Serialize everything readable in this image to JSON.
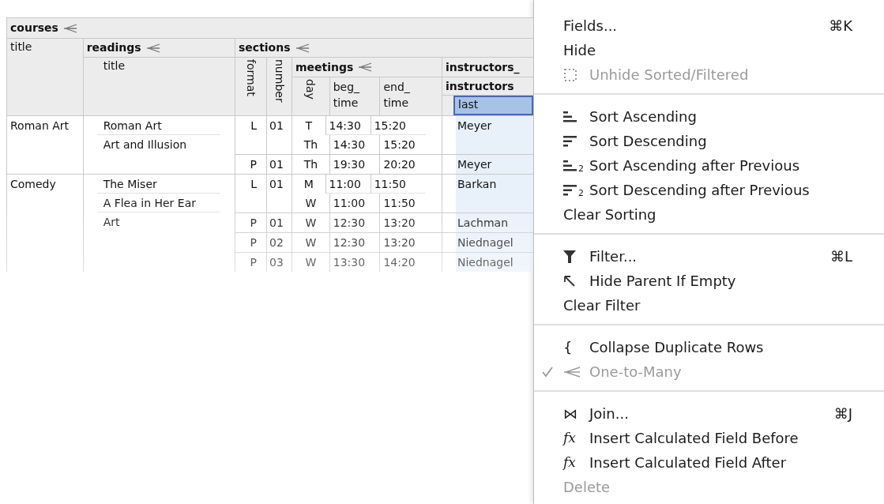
{
  "table": {
    "header": {
      "root": "courses",
      "title": "title",
      "readings": "readings",
      "readings_title": "title",
      "sections": "sections",
      "format": "format",
      "number": "number",
      "meetings": "meetings",
      "day": "day",
      "beg_time": "beg_ time",
      "end_time": "end_ time",
      "instructors_group": "instructors_",
      "instructors": "instructors",
      "last": {
        "label": "last",
        "selected": true
      }
    },
    "courses": [
      {
        "title": "Roman Art",
        "readings": [
          {
            "title": "Roman Art"
          },
          {
            "title": "Art and Illusion"
          }
        ],
        "sections": [
          {
            "format": "L",
            "number": "01",
            "instructor": "Meyer",
            "meetings": [
              {
                "day": "T",
                "beg_time": "14:30",
                "end_time": "15:20"
              },
              {
                "day": "Th",
                "beg_time": "14:30",
                "end_time": "15:20"
              }
            ]
          },
          {
            "format": "P",
            "number": "01",
            "instructor": "Meyer",
            "meetings": [
              {
                "day": "Th",
                "beg_time": "19:30",
                "end_time": "20:20"
              }
            ]
          }
        ]
      },
      {
        "title": "Comedy",
        "readings": [
          {
            "title": "The Miser"
          },
          {
            "title": "A Flea in Her Ear"
          },
          {
            "title": "Art"
          }
        ],
        "sections": [
          {
            "format": "L",
            "number": "01",
            "instructor": "Barkan",
            "meetings": [
              {
                "day": "M",
                "beg_time": "11:00",
                "end_time": "11:50"
              },
              {
                "day": "W",
                "beg_time": "11:00",
                "end_time": "11:50"
              }
            ]
          },
          {
            "format": "P",
            "number": "01",
            "instructor": "Lachman",
            "meetings": [
              {
                "day": "W",
                "beg_time": "12:30",
                "end_time": "13:20"
              }
            ]
          },
          {
            "format": "P",
            "number": "02",
            "instructor": "Niednagel",
            "meetings": [
              {
                "day": "W",
                "beg_time": "12:30",
                "end_time": "13:20"
              }
            ]
          },
          {
            "format": "P",
            "number": "03",
            "instructor": "Niednagel",
            "meetings": [
              {
                "day": "W",
                "beg_time": "13:30",
                "end_time": "14:20"
              }
            ]
          }
        ]
      }
    ]
  },
  "menu": {
    "groups": [
      [
        {
          "label": "Fields...",
          "shortcut": "⌘K",
          "kind": "plain",
          "disabled": false,
          "checked": false
        },
        {
          "label": "Hide",
          "kind": "plain",
          "disabled": false,
          "checked": false
        },
        {
          "label": "Unhide Sorted/Filtered",
          "kind": "dashed-square",
          "disabled": true,
          "checked": false
        }
      ],
      [
        {
          "label": "Sort Ascending",
          "kind": "sort-ascending",
          "disabled": false,
          "checked": false
        },
        {
          "label": "Sort Descending",
          "kind": "sort-descending",
          "disabled": false,
          "checked": false
        },
        {
          "label": "Sort Ascending after Previous",
          "kind": "sort-ascending",
          "subscript": "2",
          "disabled": false,
          "checked": false
        },
        {
          "label": "Sort Descending after Previous",
          "kind": "sort-descending",
          "subscript": "2",
          "disabled": false,
          "checked": false
        },
        {
          "label": "Clear Sorting",
          "kind": "plain",
          "disabled": false,
          "checked": false
        }
      ],
      [
        {
          "label": "Filter...",
          "shortcut": "⌘L",
          "kind": "filter",
          "disabled": false,
          "checked": false
        },
        {
          "label": "Hide Parent If Empty",
          "kind": "arrow-up-left",
          "disabled": false,
          "checked": false
        },
        {
          "label": "Clear Filter",
          "kind": "plain",
          "disabled": false,
          "checked": false
        }
      ],
      [
        {
          "label": "Collapse Duplicate Rows",
          "kind": "glyph",
          "glyph": "{",
          "disabled": false,
          "checked": false
        },
        {
          "label": "One-to-Many",
          "kind": "crow-foot",
          "disabled": true,
          "checked": true
        }
      ],
      [
        {
          "label": "Join...",
          "shortcut": "⌘J",
          "kind": "glyph",
          "glyph": "⋈",
          "disabled": false,
          "checked": false
        },
        {
          "label": "Insert Calculated Field Before",
          "kind": "formula",
          "glyph": "fx",
          "disabled": false,
          "checked": false
        },
        {
          "label": "Insert Calculated Field After",
          "kind": "formula",
          "glyph": "fx",
          "disabled": false,
          "checked": false
        },
        {
          "label": "Delete",
          "kind": "plain",
          "disabled": true,
          "checked": false
        }
      ]
    ]
  }
}
